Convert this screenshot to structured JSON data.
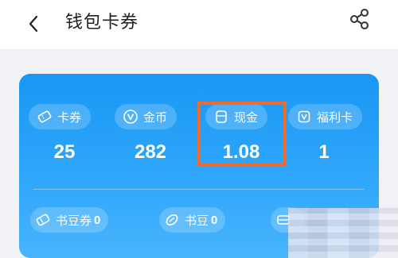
{
  "header": {
    "title": "钱包卡券"
  },
  "wallet": {
    "stats": [
      {
        "label": "卡券",
        "value": "25",
        "icon": "ticket-icon"
      },
      {
        "label": "金币",
        "value": "282",
        "icon": "coin-icon"
      },
      {
        "label": "现金",
        "value": "1.08",
        "icon": "cash-icon"
      },
      {
        "label": "福利卡",
        "value": "1",
        "icon": "welfare-card-icon"
      }
    ],
    "bottom": [
      {
        "label": "书豆券",
        "count": "0",
        "icon": "bean-ticket-icon"
      },
      {
        "label": "书豆",
        "count": "0",
        "icon": "bean-icon"
      }
    ]
  },
  "colors": {
    "card_gradient_top": "#1a97f4",
    "card_gradient_bottom": "#48b4fc",
    "highlight": "#ef6b2e"
  }
}
